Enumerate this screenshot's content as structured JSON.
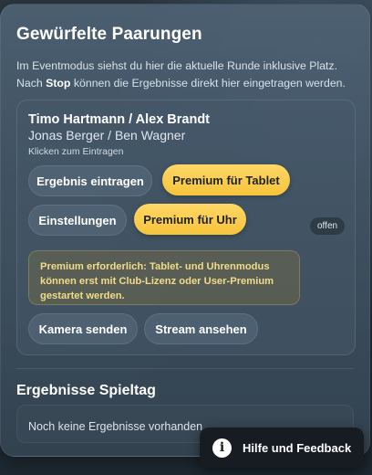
{
  "header": {
    "title": "Gewürfelte Paarungen",
    "intro_part1": "Im Eventmodus siehst du hier die aktuelle Runde inklusive Platz. Nach ",
    "intro_bold": "Stop",
    "intro_part2": " können die Ergebnisse direkt hier eingetragen werden."
  },
  "match": {
    "team1": "Timo Hartmann / Alex Brandt",
    "team2": "Jonas Berger / Ben Wagner",
    "hint": "Klicken zum Eintragen",
    "status": "offen",
    "buttons": {
      "enter_result": "Ergebnis eintragen",
      "premium_tablet": "Premium für Tablet",
      "settings": "Einstellungen",
      "premium_watch": "Premium für Uhr",
      "send_camera": "Kamera senden",
      "view_stream": "Stream ansehen"
    },
    "premium_notice": "Premium erforderlich: Tablet- und Uhrenmodus können erst mit Club-Lizenz oder User-Premium gestartet werden."
  },
  "results": {
    "title": "Ergebnisse Spieltag",
    "empty": "Noch keine Ergebnisse vorhanden."
  },
  "help": {
    "label": "Hilfe und Feedback",
    "icon": "info-icon",
    "icon_glyph": "i"
  },
  "colors": {
    "accent_gold": "#f6c43b",
    "notice_text": "#f2dc86"
  }
}
